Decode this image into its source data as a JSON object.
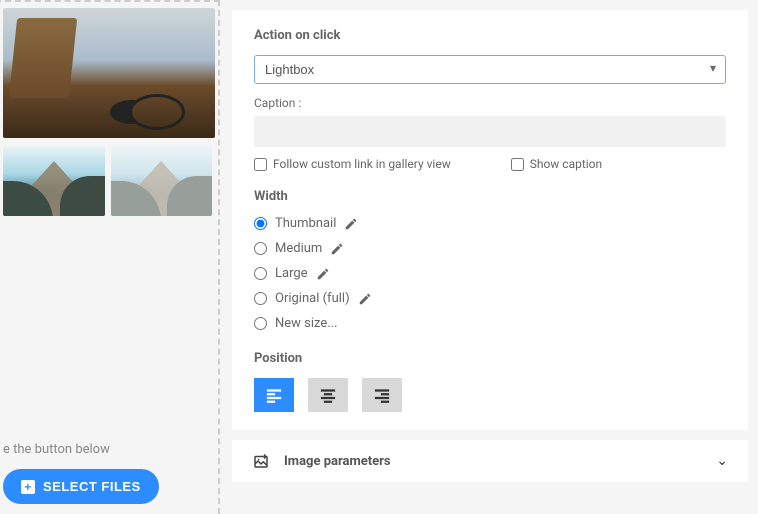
{
  "left": {
    "hint_text": "e the button below",
    "select_files_label": "SELECT FILES"
  },
  "panel": {
    "action_label": "Action on click",
    "action_value": "Lightbox",
    "caption_label": "Caption :",
    "caption_value": "",
    "checkbox_follow": "Follow custom link in gallery view",
    "checkbox_show": "Show caption",
    "width_label": "Width",
    "width_options": {
      "thumbnail": "Thumbnail",
      "medium": "Medium",
      "large": "Large",
      "original": "Original (full)",
      "newsize": "New size..."
    },
    "width_selected": "thumbnail",
    "position_label": "Position"
  },
  "accordion": {
    "image_params": "Image parameters"
  }
}
